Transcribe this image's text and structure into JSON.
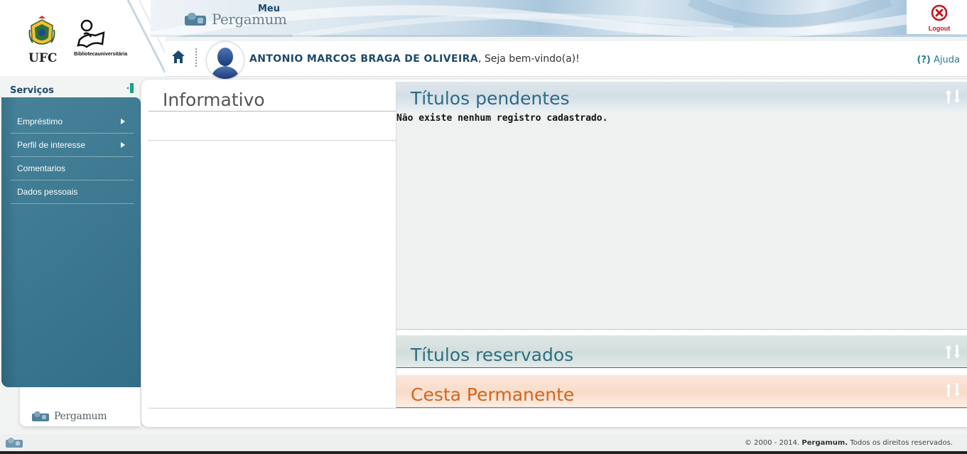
{
  "header": {
    "institution": "UFC",
    "library_logo_text": "Bibliotecauniversitária",
    "meu_label": "Meu",
    "brand": "Pergamum",
    "logout_label": "Logout",
    "user_name": "ANTONIO MARCOS BRAGA DE OLIVEIRA",
    "welcome_suffix": ", Seja bem-vindo(a)!",
    "help_mark": "(?)",
    "help_label": "Ajuda"
  },
  "sidebar": {
    "title": "Serviços",
    "items": [
      {
        "label": "Empréstimo",
        "has_submenu": true
      },
      {
        "label": "Perfil de interesse",
        "has_submenu": true
      },
      {
        "label": "Comentarios",
        "has_submenu": false
      },
      {
        "label": "Dados pessoais",
        "has_submenu": false
      }
    ],
    "brand": "Pergamum"
  },
  "main": {
    "info_title": "Informativo",
    "pending": {
      "title": "Títulos pendentes",
      "empty_message": "Não existe nenhum registro cadastrado."
    },
    "reserved": {
      "title": "Títulos reservados"
    },
    "basket": {
      "title": "Cesta Permanente"
    }
  },
  "footer": {
    "years": "© 2000 - 2014.",
    "brand": "Pergamum.",
    "rights": "Todos os direitos reservados."
  },
  "colors": {
    "primary": "#1d4a6b",
    "sidebar": "#35748d",
    "logout": "#c0141a",
    "basket_accent": "#d2661f"
  }
}
